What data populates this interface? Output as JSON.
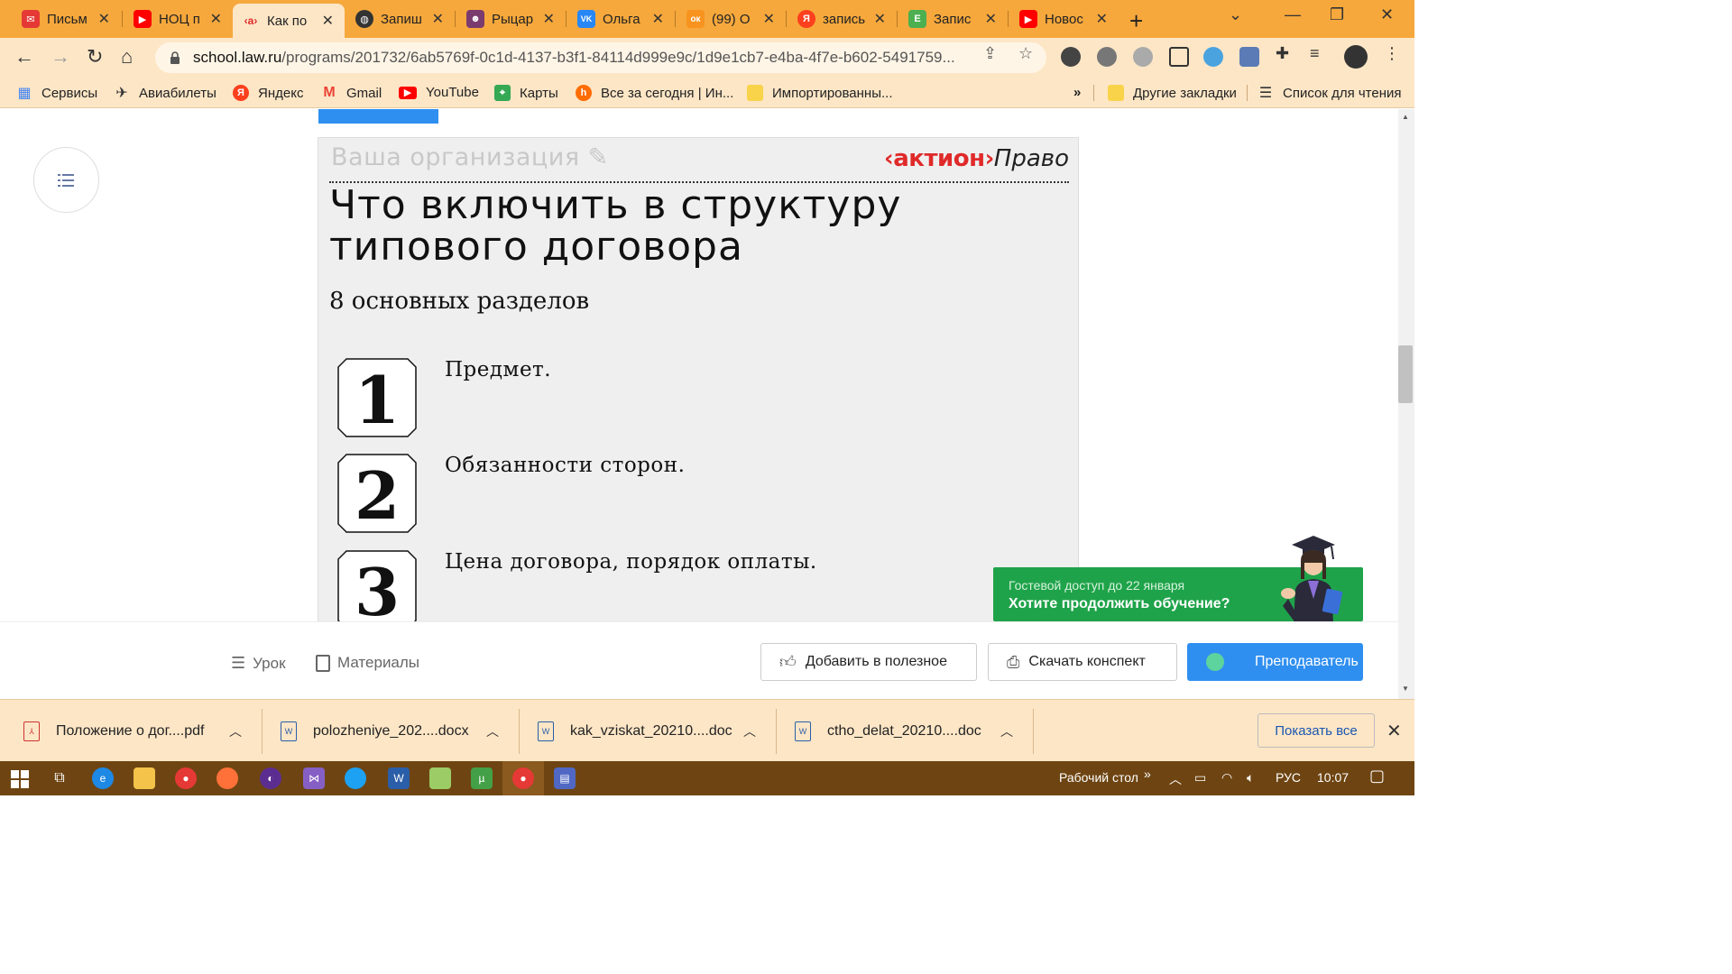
{
  "colors": {
    "tabbar": "#f6a83c",
    "toolbar": "#fde6c6",
    "accent_blue": "#2f8ff0",
    "guest_green": "#1fa34a",
    "brand_red": "#e02a2a",
    "taskbar": "#6e4512"
  },
  "tabs": [
    {
      "label": "Письм",
      "icon": "mail-icon",
      "color": "#e53935",
      "glyph": "✉"
    },
    {
      "label": "НОЦ п",
      "icon": "youtube-icon",
      "color": "#ff0000",
      "glyph": "▶"
    },
    {
      "label": "Как по",
      "icon": "aktion-icon",
      "color": "#e02a2a",
      "glyph": "‹a›"
    },
    {
      "label": "Запиш",
      "icon": "globe-icon",
      "color": "#333333",
      "glyph": "◍"
    },
    {
      "label": "Рыцар",
      "icon": "avatar-icon",
      "color": "#7a3b6e",
      "glyph": "☻"
    },
    {
      "label": "Ольга",
      "icon": "vk-icon",
      "color": "#2787f5",
      "glyph": "VK"
    },
    {
      "label": "(99) О",
      "icon": "odnoklassniki-icon",
      "color": "#f7931e",
      "glyph": "ок"
    },
    {
      "label": "запись",
      "icon": "yandex-icon",
      "color": "#fc3f1d",
      "glyph": "Я"
    },
    {
      "label": "Запис",
      "icon": "e-icon",
      "color": "#4caf50",
      "glyph": "E"
    },
    {
      "label": "Новос",
      "icon": "youtube-icon",
      "color": "#ff0000",
      "glyph": "▶"
    }
  ],
  "address": {
    "domain": "school.law.ru",
    "path": "/programs/201732/6ab5769f-0c1d-4137-b3f1-84114d999e9c/1d9e1cb7-e4ba-4f7e-b602-5491759..."
  },
  "bookmarks": {
    "items": [
      {
        "label": "Сервисы",
        "icon": "apps-grid-icon",
        "color": "#4285f4",
        "glyph": "▦"
      },
      {
        "label": "Авиабилеты",
        "icon": "plane-icon",
        "color": "#333333",
        "glyph": "✈"
      },
      {
        "label": "Яндекс",
        "icon": "yandex-icon",
        "color": "#fc3f1d",
        "glyph": "Я"
      },
      {
        "label": "Gmail",
        "icon": "gmail-icon",
        "color": "#ea4335",
        "glyph": "M"
      },
      {
        "label": "YouTube",
        "icon": "youtube-icon",
        "color": "#ff0000",
        "glyph": "▶"
      },
      {
        "label": "Карты",
        "icon": "maps-icon",
        "color": "#34a853",
        "glyph": "⌖"
      },
      {
        "label": "Все за сегодня | Ин...",
        "icon": "h-icon",
        "color": "#ff6d00",
        "glyph": "h"
      },
      {
        "label": "Импортированны...",
        "icon": "folder-icon",
        "color": "#f9d34a",
        "glyph": ""
      }
    ],
    "more": "»",
    "other": "Другие закладки",
    "reading_list": "Список для чтения"
  },
  "slide": {
    "org_placeholder": "Ваша организация",
    "brand_main": "‹актион›",
    "brand_suffix": "Право",
    "title": "Что включить в структуру типового договора",
    "subtitle": "8 основных разделов",
    "items": [
      {
        "num": "1",
        "text": "Предмет."
      },
      {
        "num": "2",
        "text": "Обязанности сторон."
      },
      {
        "num": "3",
        "text": "Цена договора, порядок оплаты."
      }
    ]
  },
  "guest": {
    "line1": "Гостевой доступ до 22 января",
    "line2": "Хотите продолжить обучение?"
  },
  "appbar": {
    "lesson": "Урок",
    "materials": "Материалы",
    "add_useful": "Добавить в полезное",
    "download": "Скачать конспект",
    "teacher": "Преподаватель"
  },
  "downloads": {
    "files": [
      {
        "name": "Положение о дог....pdf",
        "type": "pdf"
      },
      {
        "name": "polozheniye_202....docx",
        "type": "word"
      },
      {
        "name": "kak_vziskat_20210....doc",
        "type": "word"
      },
      {
        "name": "ctho_delat_20210....doc",
        "type": "word"
      }
    ],
    "show_all": "Показать все"
  },
  "taskbar": {
    "desktop": "Рабочий стол",
    "lang": "РУС",
    "time": "10:07"
  }
}
